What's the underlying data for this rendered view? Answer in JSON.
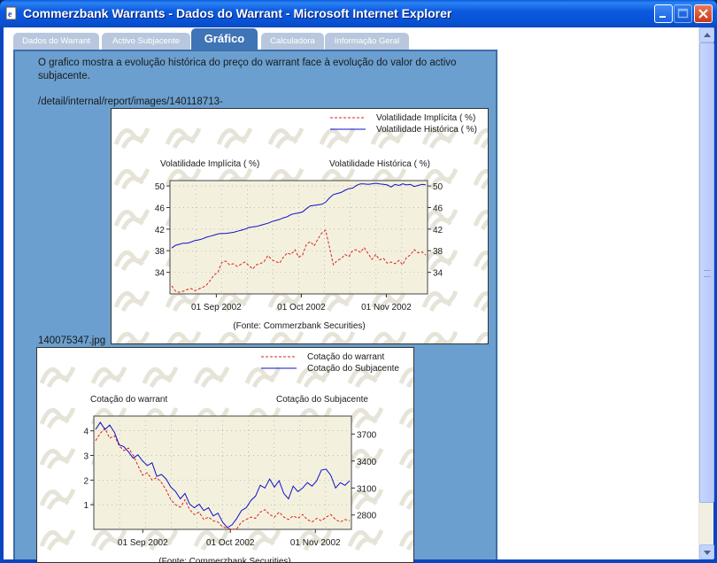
{
  "window": {
    "title": "Commerzbank Warrants - Dados do Warrant - Microsoft Internet Explorer"
  },
  "tabs": [
    {
      "label": "Dados do Warrant",
      "active": false
    },
    {
      "label": "Activo Subjacente",
      "active": false
    },
    {
      "label": "Gráfico",
      "active": true
    },
    {
      "label": "Calculadora",
      "active": false
    },
    {
      "label": "Informação Geral",
      "active": false
    }
  ],
  "content": {
    "description": "O grafico mostra a evolução histórica do preço do warrant face à evolução do valor do activo subjacente.",
    "image_path_part1": "/detail/internal/report/images/140118713-",
    "image_path_part2": "140075347.jpg"
  },
  "colors": {
    "panel": "#6a9fcf",
    "tab_active": "#3f74b6",
    "tab_inactive": "#b9c7de",
    "series_red": "#e02020",
    "series_blue": "#1010c8",
    "plot_bg": "#f3f1de"
  },
  "chart_data": [
    {
      "type": "line",
      "legend": [
        "Volatilidade Implícita ( %)",
        "Volatilidade Histórica ( %)"
      ],
      "left_axis_title": "Volatilidade Implícita ( %)",
      "right_axis_title": "Volatilidade Histórica ( %)",
      "left_ticks": [
        "50",
        "46",
        "42",
        "38",
        "34"
      ],
      "right_ticks": [
        "50",
        "46",
        "42",
        "38",
        "34"
      ],
      "x_ticks": [
        "01 Sep 2002",
        "01 Oct 2002",
        "01 Nov 2002"
      ],
      "source": "(Fonte: Commerzbank Securities)",
      "ylim": [
        30,
        51
      ],
      "series": [
        {
          "name": "Volatilidade Implícita ( %)",
          "style": "dashed",
          "values": [
            31.5,
            30.5,
            30.3,
            30.5,
            30.8,
            31,
            30.6,
            30.9,
            31.2,
            31.6,
            32.5,
            33.5,
            34,
            35.8,
            36.1,
            35.4,
            35.6,
            35.1,
            35.5,
            35.9,
            35.3,
            34.6,
            35.4,
            35.6,
            36,
            37.1,
            36.3,
            36,
            35.7,
            36.8,
            37.6,
            37.3,
            38.2,
            36.8,
            37.2,
            39.2,
            39.7,
            38.9,
            40.2,
            41.3,
            41.8,
            38.6,
            35.4,
            36.2,
            36.5,
            37.3,
            36.9,
            38,
            38.2,
            37.7,
            38.6,
            37.5,
            36.4,
            37.3,
            36.3,
            36.6,
            35.7,
            35.9,
            35.6,
            36.2,
            35.4,
            36.8,
            37.2,
            38.2,
            37.6,
            37.8,
            37.2
          ]
        },
        {
          "name": "Volatilidade Histórica ( %)",
          "style": "solid",
          "values": [
            38.5,
            39,
            39.2,
            39.4,
            39.4,
            39.6,
            39.9,
            40,
            40.2,
            40.5,
            40.7,
            40.9,
            41.1,
            41.2,
            41.2,
            41.3,
            41.4,
            41.6,
            41.8,
            42,
            42.3,
            42.4,
            42.5,
            42.7,
            42.9,
            43.1,
            43.4,
            43.6,
            43.8,
            44.1,
            44.3,
            44.7,
            44.9,
            45,
            45.2,
            45.8,
            46.3,
            46.4,
            46.5,
            46.6,
            47,
            47.8,
            48.4,
            48.6,
            48.8,
            49.2,
            49.5,
            49.6,
            50.1,
            50.4,
            50.4,
            50.3,
            50.4,
            50.5,
            50.4,
            50.3,
            50.2,
            49.8,
            50.3,
            50.1,
            50.4,
            50.2,
            50.3,
            49.9,
            50.1,
            50.3,
            50.2
          ]
        }
      ]
    },
    {
      "type": "line",
      "legend": [
        "Cotação do warrant",
        "Cotação do Subjacente"
      ],
      "left_axis_title": "Cotação do warrant",
      "right_axis_title": "Cotação do Subjacente",
      "left_ticks": [
        "4",
        "3",
        "2",
        "1"
      ],
      "right_ticks": [
        "3700",
        "3400",
        "3100",
        "2800"
      ],
      "x_ticks": [
        "01 Sep 2002",
        "01 Oct 2002",
        "01 Nov 2002"
      ],
      "source": "(Fonte: Commerzbank Securities)",
      "ylim_left": [
        0,
        4.6
      ],
      "ylim_right": [
        2640,
        3900
      ],
      "series": [
        {
          "name": "Cotação do warrant",
          "style": "dashed",
          "axis": "left",
          "values": [
            3.6,
            3.9,
            4.1,
            3.7,
            3.8,
            3.4,
            3.2,
            3.3,
            3.0,
            2.6,
            2.2,
            2.3,
            2.0,
            2.1,
            1.9,
            1.6,
            1.2,
            1.0,
            0.9,
            1.2,
            0.8,
            0.6,
            0.7,
            0.4,
            0.5,
            0.35,
            0.3,
            0.1,
            0.05,
            0.0,
            0.02,
            0.3,
            0.4,
            0.5,
            0.45,
            0.7,
            0.8,
            0.6,
            0.5,
            0.7,
            0.5,
            0.4,
            0.55,
            0.45,
            0.6,
            0.4,
            0.3,
            0.45,
            0.35,
            0.5,
            0.6,
            0.4,
            0.3,
            0.4,
            0.35
          ]
        },
        {
          "name": "Cotação do Subjacente",
          "style": "solid",
          "axis": "right",
          "values": [
            3750,
            3830,
            3750,
            3800,
            3720,
            3580,
            3560,
            3500,
            3430,
            3470,
            3400,
            3350,
            3380,
            3230,
            3250,
            3200,
            3110,
            3060,
            2980,
            3040,
            2920,
            2880,
            2920,
            2850,
            2880,
            2790,
            2820,
            2720,
            2660,
            2690,
            2760,
            2850,
            2880,
            2960,
            3010,
            3130,
            3100,
            3200,
            3110,
            3180,
            3040,
            2980,
            3120,
            3060,
            3100,
            3160,
            3120,
            3180,
            3300,
            3310,
            3240,
            3100,
            3160,
            3130,
            3180
          ]
        }
      ]
    }
  ]
}
